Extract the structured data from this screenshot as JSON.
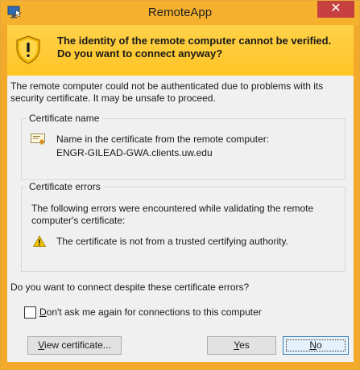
{
  "window": {
    "title": "RemoteApp",
    "close_label": "✕"
  },
  "banner": {
    "message": "The identity of the remote computer cannot be verified. Do you want to connect anyway?",
    "icon": "shield-warning-icon"
  },
  "intro": "The remote computer could not be authenticated due to problems with its security certificate. It may be unsafe to proceed.",
  "certificate_name": {
    "title": "Certificate name",
    "line1": "Name in the certificate from the remote computer:",
    "line2": "ENGR-GILEAD-GWA.clients.uw.edu",
    "icon": "certificate-icon"
  },
  "certificate_errors": {
    "title": "Certificate errors",
    "description": "The following errors were encountered while validating the remote computer's certificate:",
    "error": "The certificate is not from a trusted certifying authority.",
    "icon": "warning-icon"
  },
  "question": "Do you want to connect despite these certificate errors?",
  "checkbox": {
    "accel": "D",
    "label_rest": "on't ask me again for connections to this computer",
    "checked": false
  },
  "buttons": {
    "view_accel": "V",
    "view_rest": "iew certificate...",
    "yes_accel": "Y",
    "yes_rest": "es",
    "no_accel": "N",
    "no_rest": "o"
  },
  "colors": {
    "titlebar": "#f5b02d",
    "banner": "#ffc425",
    "close": "#c74040",
    "content": "#f0f0f0"
  }
}
